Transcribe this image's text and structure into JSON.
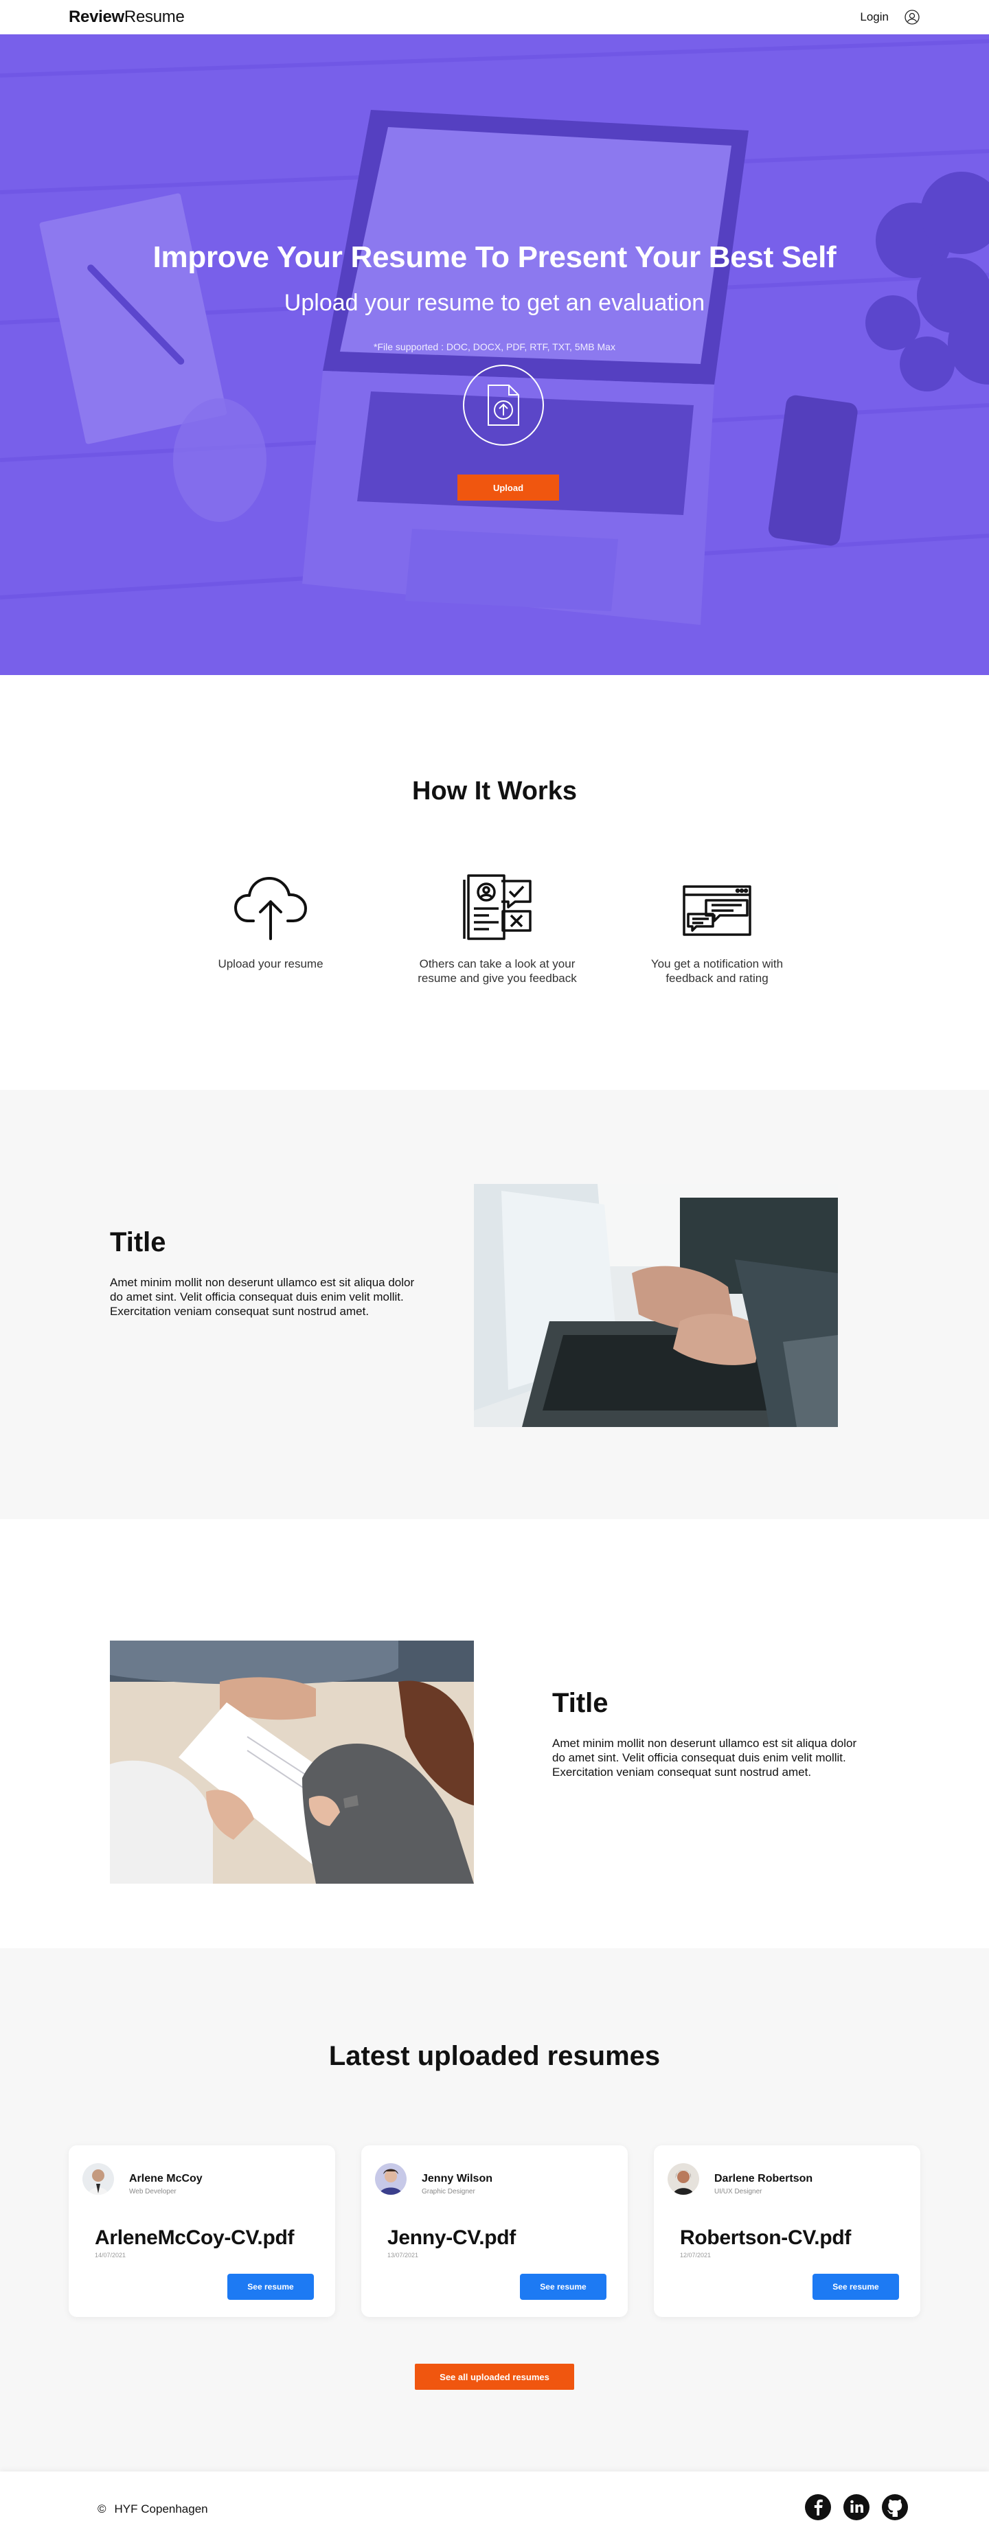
{
  "nav": {
    "logo_bold": "Review",
    "logo_light": "Resume",
    "login_label": "Login",
    "user_icon": "user-circle-icon"
  },
  "hero": {
    "title": "Improve Your Resume To Present Your Best Self",
    "subtitle": "Upload your resume to get an evaluation",
    "note": "*File supported : DOC, DOCX, PDF, RTF, TXT, 5MB Max",
    "upload_icon": "file-upload-icon",
    "upload_label": "Upload",
    "overlay_color": "#6950eb",
    "button_color": "#f0560f"
  },
  "how": {
    "title": "How It Works",
    "steps": [
      {
        "icon": "cloud-upload-icon",
        "text": "Upload your resume"
      },
      {
        "icon": "resume-review-icon",
        "text": "Others can take a look at your resume and give you feedback"
      },
      {
        "icon": "notification-chat-icon",
        "text": "You get a notification with feedback and rating"
      }
    ]
  },
  "features": [
    {
      "title": "Title",
      "text": "Amet minim mollit non deserunt ullamco est sit aliqua dolor do amet sint. Velit officia consequat duis enim velit mollit. Exercitation veniam consequat sunt nostrud amet."
    },
    {
      "title": "Title",
      "text": "Amet minim mollit non deserunt ullamco est sit aliqua dolor do amet sint. Velit officia consequat duis enim velit mollit. Exercitation veniam consequat sunt nostrud amet."
    }
  ],
  "latest": {
    "title": "Latest uploaded resumes",
    "cards": [
      {
        "name": "Arlene McCoy",
        "role": "Web Developer",
        "file": "ArleneMcCoy-CV.pdf",
        "date": "14/07/2021",
        "button": "See resume"
      },
      {
        "name": "Jenny Wilson",
        "role": "Graphic Designer",
        "file": "Jenny-CV.pdf",
        "date": "13/07/2021",
        "button": "See resume"
      },
      {
        "name": "Darlene Robertson",
        "role": "UI/UX Designer",
        "file": "Robertson-CV.pdf",
        "date": "12/07/2021",
        "button": "See resume"
      }
    ],
    "see_all_label": "See all uploaded resumes",
    "button_color": "#1d7af3"
  },
  "footer": {
    "copyright_symbol": "©",
    "copyright_text": "HYF Copenhagen",
    "social_icons": [
      "facebook-icon",
      "linkedin-icon",
      "github-icon"
    ]
  }
}
